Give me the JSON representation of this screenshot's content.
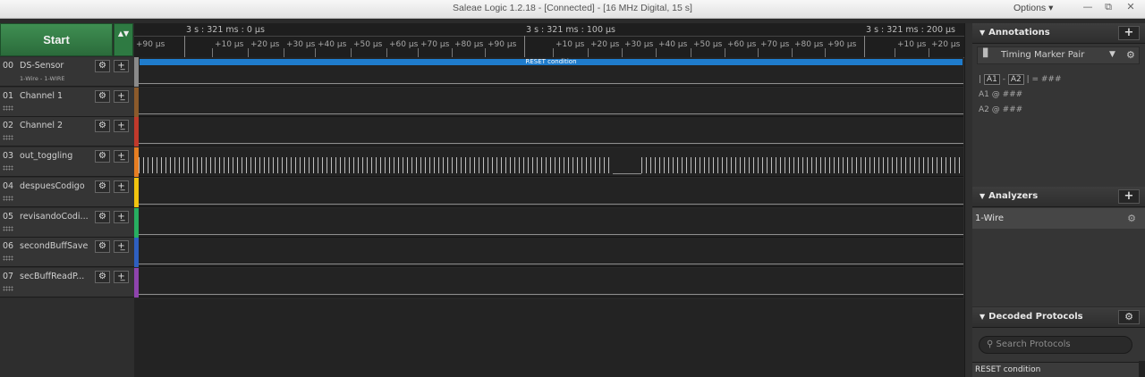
{
  "window": {
    "title": "Saleae Logic 1.2.18 - [Connected] - [16 MHz Digital, 15 s]",
    "options_label": "Options ▾",
    "controls": [
      "—",
      "⧉",
      "✕"
    ]
  },
  "toolbar": {
    "start_label": "Start",
    "arrows_label": "▲▼"
  },
  "ruler": {
    "major_labels": [
      "3 s : 321 ms : 0 µs",
      "3 s : 321 ms : 100 µs",
      "3 s : 321 ms : 200 µs"
    ],
    "minor_labels": [
      "+90 µs",
      "+10 µs",
      "+20 µs",
      "+30 µs",
      "+40 µs",
      "+50 µs",
      "+60 µs",
      "+70 µs",
      "+80 µs",
      "+90 µs",
      "+10 µs",
      "+20 µs",
      "+30 µs",
      "+40 µs",
      "+50 µs",
      "+60 µs",
      "+70 µs",
      "+80 µs",
      "+90 µs",
      "+10 µs",
      "+20 µs"
    ]
  },
  "channels": [
    {
      "num": "00",
      "name": "DS-Sensor",
      "sub": "1-Wire - 1-WIRE",
      "color": "#8a8a8a"
    },
    {
      "num": "01",
      "name": "Channel 1",
      "sub": "",
      "color": "#8b5a2b"
    },
    {
      "num": "02",
      "name": "Channel 2",
      "sub": "",
      "color": "#c0392b"
    },
    {
      "num": "03",
      "name": "out_toggling",
      "sub": "",
      "color": "#e67e22"
    },
    {
      "num": "04",
      "name": "despuesCodigo",
      "sub": "",
      "color": "#f1c40f"
    },
    {
      "num": "05",
      "name": "revisandoCodi...",
      "sub": "",
      "color": "#27ae60"
    },
    {
      "num": "06",
      "name": "secondBuffSave",
      "sub": "",
      "color": "#2e5fc0"
    },
    {
      "num": "07",
      "name": "secBuffReadP...",
      "sub": "",
      "color": "#8e44ad"
    }
  ],
  "channel_controls": {
    "gear": "⚙",
    "plus": "+̲"
  },
  "waves": {
    "reset_label": "RESET condition"
  },
  "annotations": {
    "header": "Annotations",
    "add": "+",
    "marker_pair": "Timing Marker Pair",
    "pin": "▊",
    "arrow": "▼",
    "gear": "⚙",
    "diff": {
      "bar": "|",
      "a1": "A1",
      "minus": "-",
      "a2": "A2",
      "rest": "| = ###"
    },
    "a1_line": "A1  @  ###",
    "a2_line": "A2  @  ###"
  },
  "analyzers": {
    "header": "Analyzers",
    "add": "+",
    "items": [
      {
        "label": "1-Wire",
        "gear": "⚙"
      }
    ]
  },
  "decoded": {
    "header": "Decoded Protocols",
    "gear": "⚙",
    "search_placeholder": "Search Protocols",
    "search_icon": "⚲",
    "results": [
      "RESET condition"
    ]
  }
}
